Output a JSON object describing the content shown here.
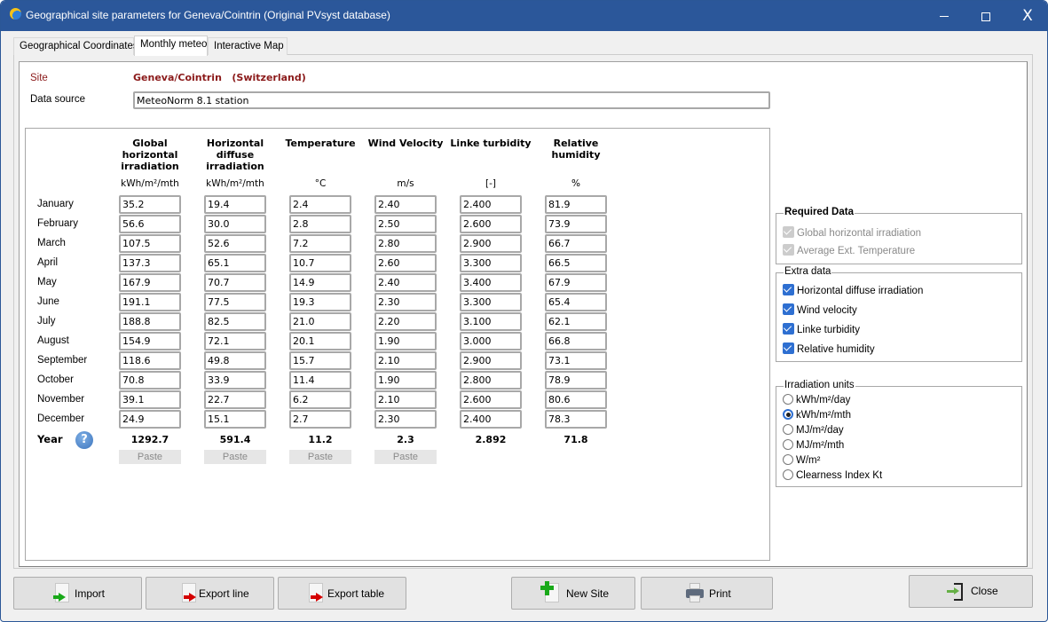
{
  "window": {
    "title": "Geographical site parameters for Geneva/Cointrin (Original PVsyst database)",
    "controls": {
      "minimize": "minimize",
      "maximize": "maximize",
      "close": "X"
    }
  },
  "tabs": [
    {
      "label": "Geographical Coordinates",
      "active": false
    },
    {
      "label": "Monthly meteo",
      "active": true
    },
    {
      "label": "Interactive Map",
      "active": false
    }
  ],
  "site": {
    "label": "Site",
    "value": "Geneva/Cointrin   (Switzerland)"
  },
  "data_source": {
    "label": "Data source",
    "value": "MeteoNorm 8.1 station"
  },
  "table": {
    "columns": [
      {
        "header": [
          "Global",
          "horizontal",
          "irradiation"
        ],
        "unit": "kWh/m²/mth"
      },
      {
        "header": [
          "Horizontal",
          "diffuse",
          "irradiation"
        ],
        "unit": "kWh/m²/mth"
      },
      {
        "header": [
          "Temperature"
        ],
        "unit": "°C"
      },
      {
        "header": [
          "Wind Velocity"
        ],
        "unit": "m/s"
      },
      {
        "header": [
          "Linke turbidity"
        ],
        "unit": "[-]"
      },
      {
        "header": [
          "Relative",
          "humidity"
        ],
        "unit": "%"
      }
    ],
    "rows": [
      {
        "month": "January",
        "values": [
          "35.2",
          "19.4",
          "2.4",
          "2.40",
          "2.400",
          "81.9"
        ]
      },
      {
        "month": "February",
        "values": [
          "56.6",
          "30.0",
          "2.8",
          "2.50",
          "2.600",
          "73.9"
        ]
      },
      {
        "month": "March",
        "values": [
          "107.5",
          "52.6",
          "7.2",
          "2.80",
          "2.900",
          "66.7"
        ]
      },
      {
        "month": "April",
        "values": [
          "137.3",
          "65.1",
          "10.7",
          "2.60",
          "3.300",
          "66.5"
        ]
      },
      {
        "month": "May",
        "values": [
          "167.9",
          "70.7",
          "14.9",
          "2.40",
          "3.400",
          "67.9"
        ]
      },
      {
        "month": "June",
        "values": [
          "191.1",
          "77.5",
          "19.3",
          "2.30",
          "3.300",
          "65.4"
        ]
      },
      {
        "month": "July",
        "values": [
          "188.8",
          "82.5",
          "21.0",
          "2.20",
          "3.100",
          "62.1"
        ]
      },
      {
        "month": "August",
        "values": [
          "154.9",
          "72.1",
          "20.1",
          "1.90",
          "3.000",
          "66.8"
        ]
      },
      {
        "month": "September",
        "values": [
          "118.6",
          "49.8",
          "15.7",
          "2.10",
          "2.900",
          "73.1"
        ]
      },
      {
        "month": "October",
        "values": [
          "70.8",
          "33.9",
          "11.4",
          "1.90",
          "2.800",
          "78.9"
        ]
      },
      {
        "month": "November",
        "values": [
          "39.1",
          "22.7",
          "6.2",
          "2.10",
          "2.600",
          "80.6"
        ]
      },
      {
        "month": "December",
        "values": [
          "24.9",
          "15.1",
          "2.7",
          "2.30",
          "2.400",
          "78.3"
        ]
      }
    ],
    "year": {
      "label": "Year",
      "help_icon": "question-mark-icon",
      "totals": [
        "1292.7",
        "591.4",
        "11.2",
        "2.3",
        "2.892",
        "71.8"
      ]
    },
    "paste_label": "Paste",
    "paste_columns": 4
  },
  "required_data": {
    "title": "Required Data",
    "items": [
      {
        "label": "Global horizontal irradiation",
        "checked": true,
        "enabled": false
      },
      {
        "label": "Average Ext. Temperature",
        "checked": true,
        "enabled": false
      }
    ]
  },
  "extra_data": {
    "title": "Extra data",
    "items": [
      {
        "label": "Horizontal diffuse irradiation",
        "checked": true
      },
      {
        "label": "Wind velocity",
        "checked": true
      },
      {
        "label": "Linke turbidity",
        "checked": true
      },
      {
        "label": "Relative humidity",
        "checked": true
      }
    ]
  },
  "irradiation_units": {
    "title": "Irradiation units",
    "options": [
      "kWh/m²/day",
      "kWh/m²/mth",
      "MJ/m²/day",
      "MJ/m²/mth",
      "W/m²",
      "Clearness Index Kt"
    ],
    "selected": "kWh/m²/mth"
  },
  "buttons": {
    "import": "Import",
    "export_line": "Export line",
    "export_table": "Export table",
    "new_site": "New Site",
    "print": "Print",
    "close": "Close"
  },
  "colors": {
    "titlebar": "#2b579a",
    "site_text": "#8b1a1a",
    "checkbox_accent": "#2e6fd1"
  }
}
